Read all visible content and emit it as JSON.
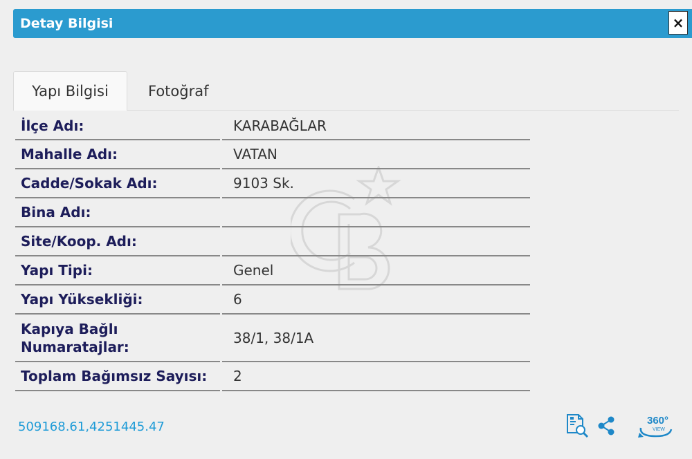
{
  "header": {
    "title": "Detay Bilgisi",
    "close_label": "×"
  },
  "tabs": [
    {
      "label": "Yapı Bilgisi",
      "active": true
    },
    {
      "label": "Fotoğraf",
      "active": false
    }
  ],
  "rows": [
    {
      "label": "İlçe Adı:",
      "value": "KARABAĞLAR"
    },
    {
      "label": "Mahalle Adı:",
      "value": "VATAN"
    },
    {
      "label": "Cadde/Sokak Adı:",
      "value": "9103 Sk."
    },
    {
      "label": "Bina Adı:",
      "value": ""
    },
    {
      "label": "Site/Koop. Adı:",
      "value": ""
    },
    {
      "label": "Yapı Tipi:",
      "value": "Genel"
    },
    {
      "label": "Yapı Yüksekliği:",
      "value": "6"
    },
    {
      "label": "Kapıya Bağlı Numaratajlar:",
      "value": "38/1, 38/1A"
    },
    {
      "label": "Toplam Bağımsız Sayısı:",
      "value": "2"
    }
  ],
  "footer": {
    "coordinates": "509168.61,4251445.47",
    "icons": [
      "document-search-icon",
      "share-icon",
      "view-360-icon"
    ],
    "view360_label": "360°",
    "view360_sub": "VIEW"
  },
  "colors": {
    "header": "#2b9bcf",
    "label_text": "#1d1d5a",
    "link": "#1e9bd7"
  },
  "watermark": {
    "text": "CB"
  }
}
